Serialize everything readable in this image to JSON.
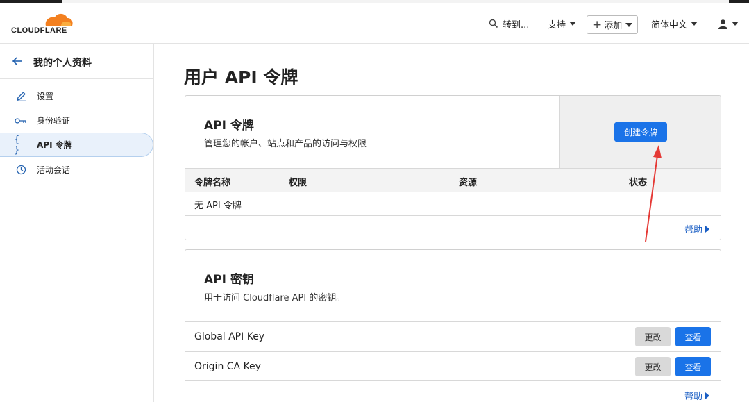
{
  "header": {
    "logo_text": "CLOUDFLARE",
    "search_label": "转到...",
    "support_label": "支持",
    "add_label": "添加",
    "language_label": "简体中文"
  },
  "sidebar": {
    "back_title": "我的个人资料",
    "items": [
      {
        "label": "设置",
        "icon": "pencil-icon"
      },
      {
        "label": "身份验证",
        "icon": "key-icon"
      },
      {
        "label": "API 令牌",
        "icon": "braces-icon",
        "active": true
      },
      {
        "label": "活动会话",
        "icon": "clock-icon"
      }
    ]
  },
  "page": {
    "title": "用户 API 令牌"
  },
  "tokens_card": {
    "title": "API 令牌",
    "description": "管理您的帐户、站点和产品的访问与权限",
    "create_button": "创建令牌",
    "columns": [
      "令牌名称",
      "权限",
      "资源",
      "状态"
    ],
    "empty_text": "无 API 令牌",
    "help_link": "帮助"
  },
  "keys_card": {
    "title": "API 密钥",
    "description": "用于访问 Cloudflare API 的密钥。",
    "rows": [
      {
        "name": "Global API Key",
        "change": "更改",
        "view": "查看"
      },
      {
        "name": "Origin CA Key",
        "change": "更改",
        "view": "查看"
      }
    ],
    "help_link": "帮助"
  },
  "colors": {
    "primary": "#1a73e8",
    "brand_orange": "#f38020",
    "annotation_arrow": "#e53935"
  }
}
